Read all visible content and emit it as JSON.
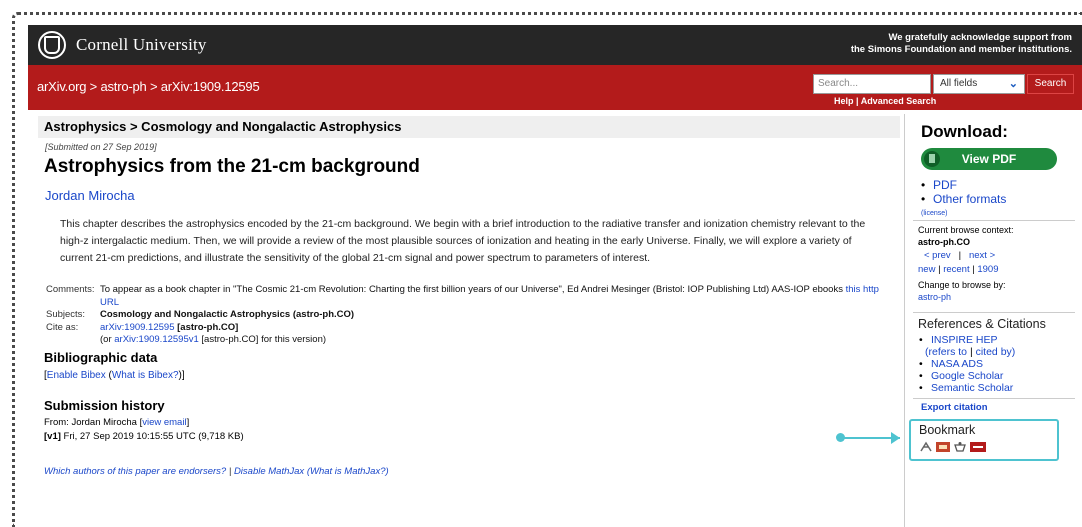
{
  "header": {
    "university": "Cornell University",
    "support_line1": "We gratefully acknowledge support from",
    "support_line2": "the Simons Foundation and member institutions."
  },
  "nav": {
    "breadcrumb": "arXiv.org > astro-ph > arXiv:1909.12595",
    "search_placeholder": "Search...",
    "field_select": "All fields",
    "search_button": "Search",
    "help_links": "Help | Advanced Search"
  },
  "paper": {
    "subject_header": "Astrophysics > Cosmology and Nongalactic Astrophysics",
    "submitted": "[Submitted on 27 Sep 2019]",
    "title": "Astrophysics from the 21-cm background",
    "author": "Jordan Mirocha",
    "abstract": "This chapter describes the astrophysics encoded by the 21-cm background. We begin with a brief introduction to the radiative transfer and ionization chemistry relevant to the high-z intergalactic medium. Then, we will provide a review of the most plausible sources of ionization and heating in the early Universe. Finally, we will explore a variety of current 21-cm predictions, and illustrate the sensitivity of the global 21-cm signal and power spectrum to parameters of interest.",
    "comments_key": "Comments:",
    "comments_val": "To appear as a book chapter in \"The Cosmic 21-cm Revolution: Charting the first billion years of our Universe\", Ed Andrei Mesinger (Bristol: IOP Publishing Ltd) AAS-IOP ebooks",
    "comments_link": "this http URL",
    "subjects_key": "Subjects:",
    "subjects_val": "Cosmology and Nongalactic Astrophysics (astro-ph.CO)",
    "cite_key": "Cite as:",
    "cite_link": "arXiv:1909.12595",
    "cite_tag": "[astro-ph.CO]",
    "cite_or": "(or",
    "cite_v1_link": "arXiv:1909.12595v1",
    "cite_v1_tag": "[astro-ph.CO] for this version)"
  },
  "biblio": {
    "heading": "Bibliographic data",
    "open_bracket": "[",
    "enable": "Enable Bibex",
    "what_open": "(",
    "what": "What is Bibex?",
    "close": ")]"
  },
  "history": {
    "heading": "Submission history",
    "from_label": "From: Jordan Mirocha",
    "view_open": "[",
    "view_email": "view email",
    "view_close": "]",
    "v1": "[v1]",
    "v1_detail": "Fri, 27 Sep 2019 10:15:55 UTC (9,718 KB)"
  },
  "footer_links": {
    "endorsers": "Which authors of this paper are endorsers?",
    "sep": " | ",
    "mathjax": "Disable MathJax",
    "what_mathjax": "(What is MathJax?)"
  },
  "sidebar": {
    "download_title": "Download:",
    "view_pdf": "View PDF",
    "pdf": "PDF",
    "other_formats": "Other formats",
    "license": "(license)",
    "browse_context_label": "Current browse context:",
    "browse_context": "astro-ph.CO",
    "prev": "< prev",
    "pipe": "|",
    "next": "next >",
    "new": "new",
    "recent": "recent",
    "year": "1909",
    "change_label": "Change to browse by:",
    "change_link": "astro-ph",
    "refs_heading": "References & Citations",
    "inspire": "INSPIRE HEP",
    "refers_to": "(refers to",
    "cited_by": "cited by)",
    "nasa": "NASA ADS",
    "google": "Google Scholar",
    "semantic": "Semantic Scholar",
    "export": "Export citation",
    "bookmark": "Bookmark"
  },
  "colors": {
    "arxiv_red": "#b31b1b",
    "link_blue": "#1a47c9",
    "pdf_green": "#1f8a3e",
    "callout": "#4ec3d0"
  }
}
